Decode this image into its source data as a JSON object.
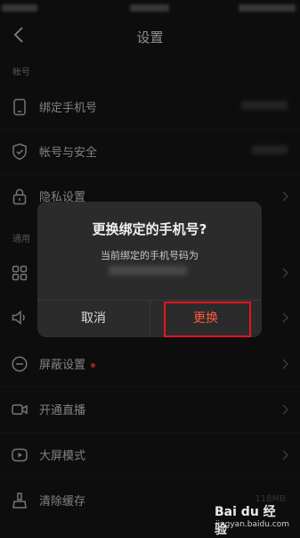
{
  "header": {
    "title": "设置"
  },
  "sections": {
    "account": "帐号",
    "general": "通用"
  },
  "account_items": [
    {
      "label": "绑定手机号",
      "icon": "phone-icon"
    },
    {
      "label": "帐号与安全",
      "icon": "shield-icon"
    },
    {
      "label": "隐私设置",
      "icon": "lock-icon"
    }
  ],
  "general_items": [
    {
      "label": "",
      "icon": "grid-icon"
    },
    {
      "label": "",
      "icon": "speaker-icon"
    },
    {
      "label": "屏蔽设置",
      "icon": "block-icon",
      "badge": true
    },
    {
      "label": "开通直播",
      "icon": "video-camera-icon"
    },
    {
      "label": "大屏模式",
      "icon": "play-circle-icon"
    },
    {
      "label": "清除缓存",
      "icon": "broom-icon",
      "value": "118MB"
    }
  ],
  "dialog": {
    "title": "更换绑定的手机号?",
    "message": "当前绑定的手机号码为",
    "cancel_label": "取消",
    "confirm_label": "更换"
  },
  "watermark": {
    "logo": "Bai du 经验",
    "url": "jingyan.baidu.com"
  },
  "colors": {
    "accent": "#ff5a3c",
    "highlight_box": "#e8131f",
    "badge": "#e8402a"
  }
}
